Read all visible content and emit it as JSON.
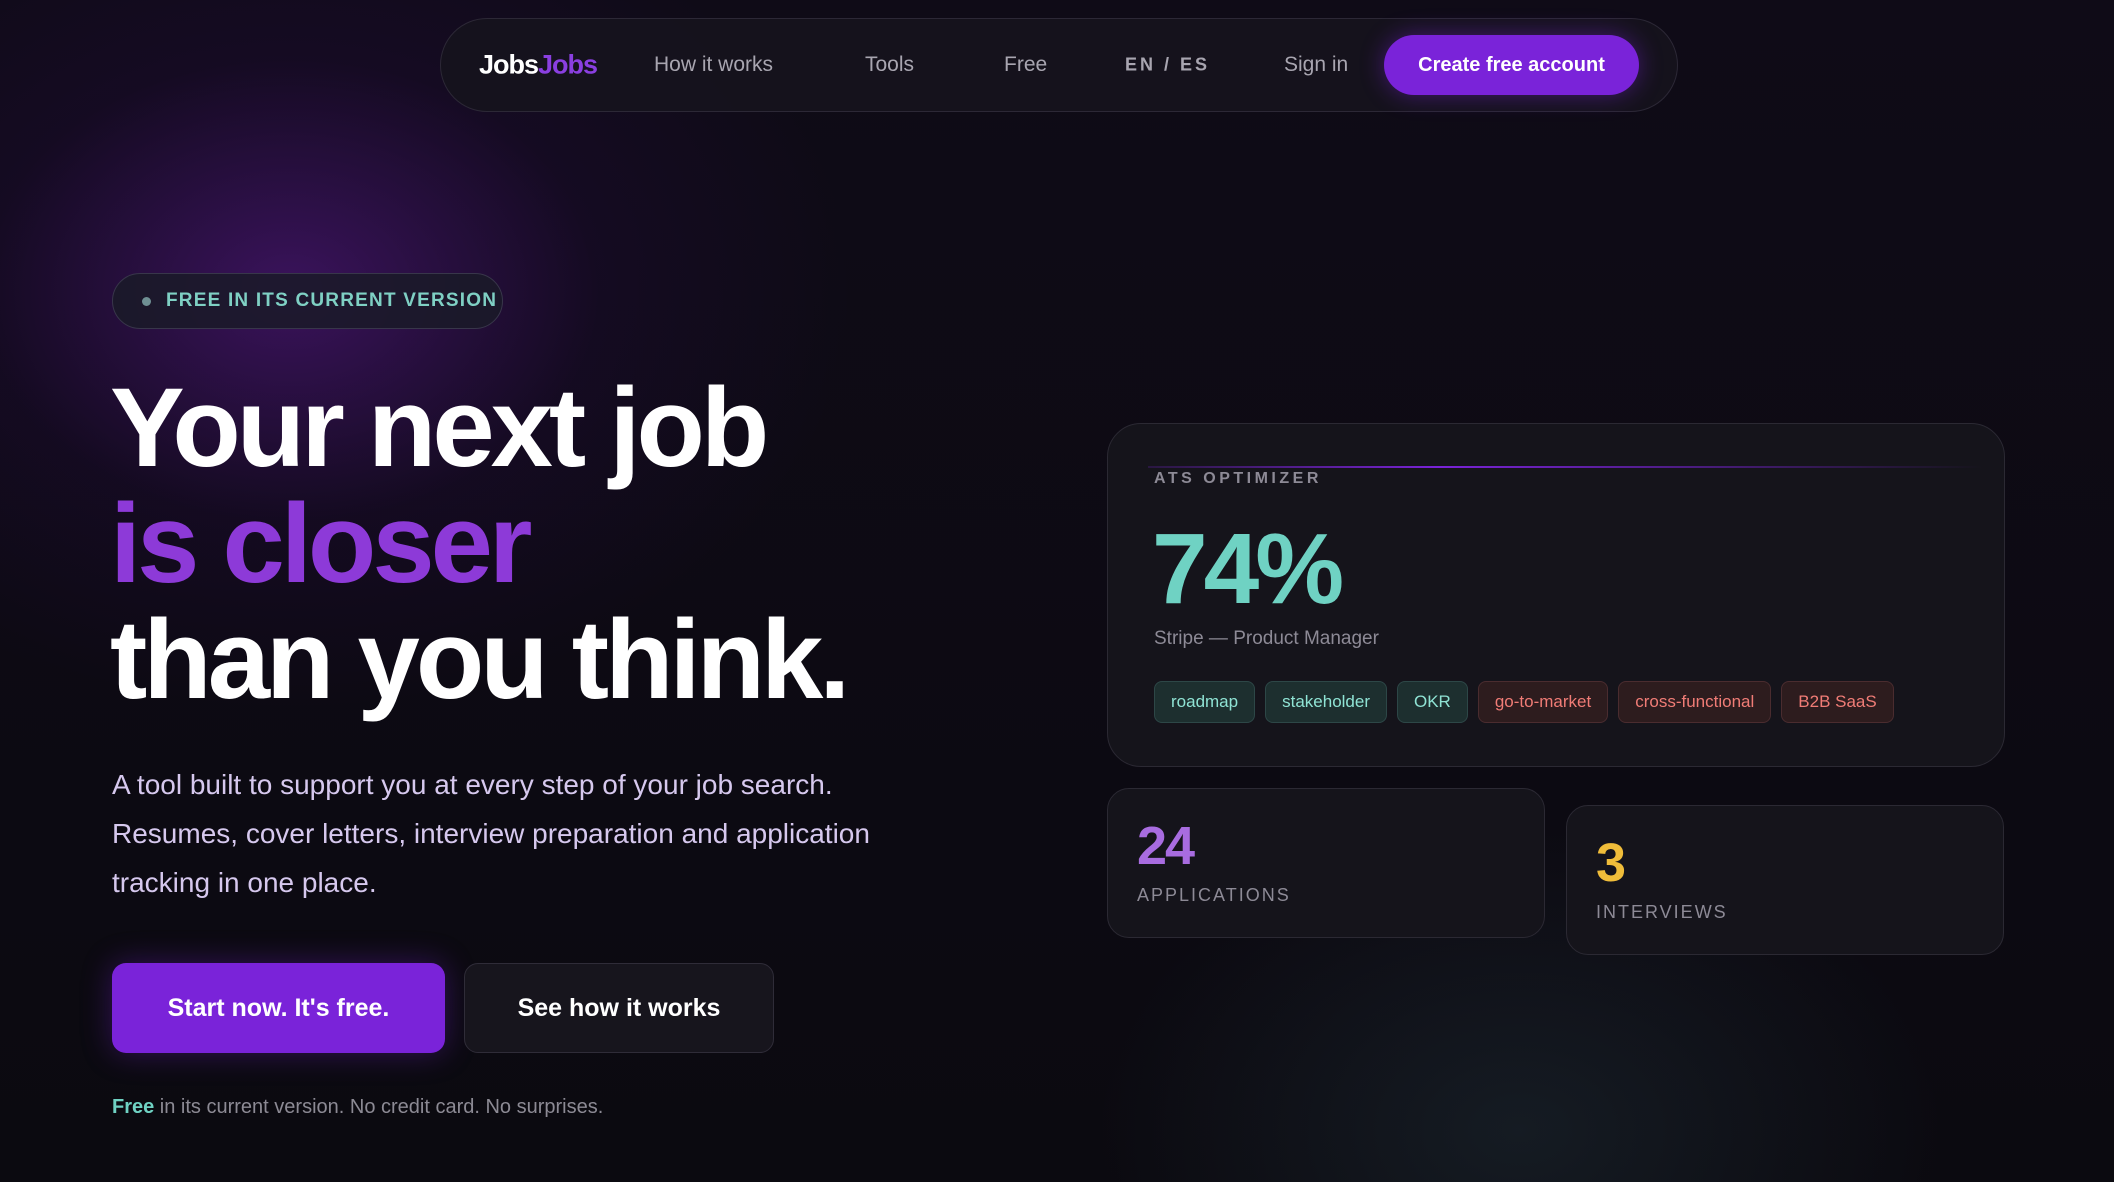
{
  "nav": {
    "logo_part1": "Jobs",
    "logo_part2": "Jobs",
    "links": [
      "How it works",
      "Tools",
      "Free"
    ],
    "language": "EN / ES",
    "sign_in": "Sign in",
    "cta": "Create free account"
  },
  "hero": {
    "badge": "FREE IN ITS CURRENT VERSION",
    "headline_line1": "Your next job",
    "headline_line2": "is closer",
    "headline_line3": "than you think.",
    "subtitle": "A tool built to support you at every step of your job search. Resumes, cover letters, interview preparation and application tracking in one place.",
    "primary_button": "Start now. It's free.",
    "secondary_button": "See how it works",
    "fine_print_highlight": "Free",
    "fine_print_rest": " in its current version. No credit card. No surprises."
  },
  "ats_card": {
    "label": "ATS OPTIMIZER",
    "score": "74%",
    "role": "Stripe — Product Manager",
    "tags": [
      {
        "text": "roadmap",
        "status": "match"
      },
      {
        "text": "stakeholder",
        "status": "match"
      },
      {
        "text": "OKR",
        "status": "match"
      },
      {
        "text": "go-to-market",
        "status": "missing"
      },
      {
        "text": "cross-functional",
        "status": "missing"
      },
      {
        "text": "B2B SaaS",
        "status": "missing"
      }
    ]
  },
  "stats": {
    "applications_value": "24",
    "applications_label": "APPLICATIONS",
    "interviews_value": "3",
    "interviews_label": "INTERVIEWS"
  },
  "colors": {
    "accent": "#7a23d9",
    "teal": "#6fd2c3",
    "yellow": "#f0bd3a",
    "background": "#0c0a12"
  }
}
